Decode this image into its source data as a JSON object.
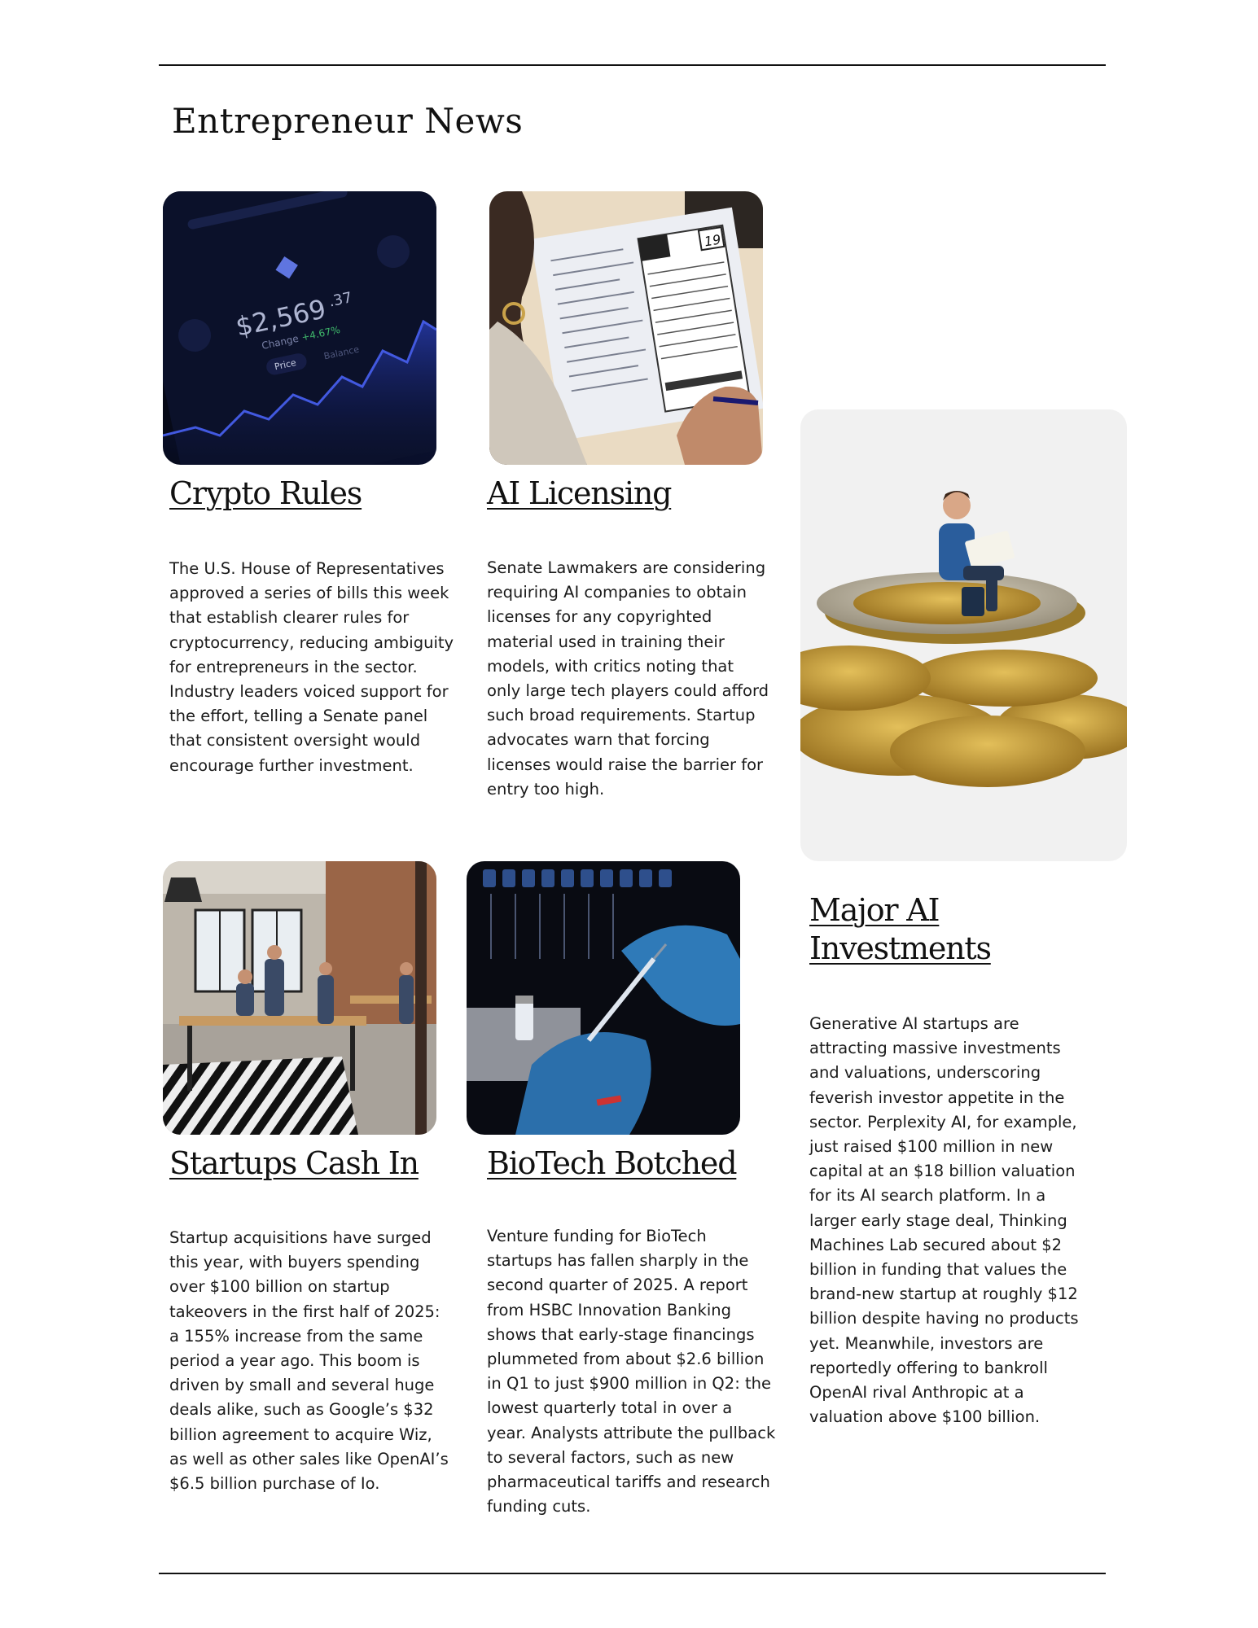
{
  "page": {
    "title": "Entrepreneur News"
  },
  "articles": [
    {
      "headline": "Crypto Rules",
      "body": "The U.S. House of Representatives approved a series of bills this week that establish clearer rules for cryptocurrency, reducing ambiguity for entrepreneurs in the sector. Industry leaders voiced support for the effort, telling a Senate panel that consistent oversight would encourage further investment.",
      "image": {
        "price_main": "$2,569",
        "price_cents": ".37",
        "change_label": "Change",
        "change_value": "+4.67%",
        "tab_price": "Price",
        "tab_balance": "Balance"
      }
    },
    {
      "headline": "AI Licensing",
      "body": "Senate Lawmakers are considering requiring AI companies to obtain licenses for any copyrighted material used in training their models, with critics noting that only large tech players could afford such broad requirements. Startup advocates warn that forcing licenses would raise the barrier for entry too high.",
      "image": {
        "form_number": "19"
      }
    },
    {
      "headline": "Startups Cash In",
      "body": "Startup acquisitions have surged this year, with buyers spending over $100 billion on startup takeovers in the first half of 2025: a 155% increase from the same period a year ago. This boom is driven by small and several huge deals alike, such as Google’s $32 billion agreement to acquire Wiz, as well as other sales like OpenAI’s $6.5 billion purchase of Io."
    },
    {
      "headline": "BioTech Botched",
      "body": "Venture funding for BioTech startups has fallen sharply in the second quarter of 2025. A report from HSBC Innovation Banking shows that early-stage financings  plummeted from about $2.6 billion in Q1 to just $900 million in Q2: the lowest quarterly total in over a year. Analysts attribute the pullback to several factors, such as new pharmaceutical tariffs and research funding cuts."
    },
    {
      "headline": "Major AI Investments",
      "body": "Generative AI startups are attracting massive investments and valuations, underscoring feverish investor appetite in the sector. Perplexity AI, for example, just raised $100 million in new capital at an $18 billion valuation for its AI search platform. In a larger early stage deal, Thinking Machines Lab secured about $2 billion in funding that values the brand-new startup at roughly $12 billion despite having no products yet. Meanwhile, investors are reportedly offering to bankroll OpenAI rival Anthropic at a valuation above $100 billion."
    }
  ]
}
